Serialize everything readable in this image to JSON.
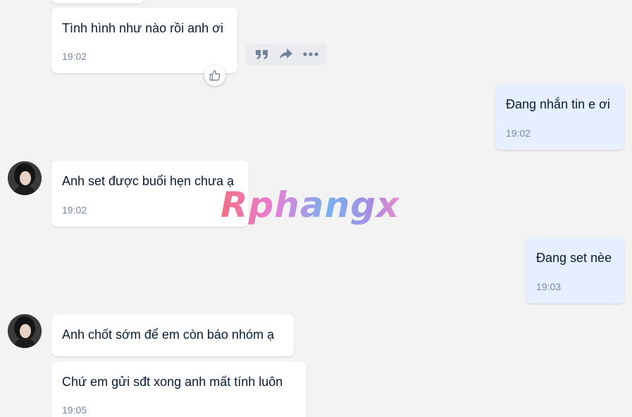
{
  "watermark": "Rphangx",
  "messages": {
    "m1": {
      "text": "Tình hình như nào rồi anh ơi",
      "time": "19:02"
    },
    "m2": {
      "text": "Đang nhắn tin e ơi",
      "time": "19:02"
    },
    "m3": {
      "text": "Anh set được buổi hẹn chưa ạ",
      "time": "19:02"
    },
    "m4": {
      "text": "Đang set nèe",
      "time": "19:03"
    },
    "m5": {
      "text": "Anh chốt sớm để em còn báo nhóm ạ"
    },
    "m6": {
      "text": "Chứ em gửi sđt xong anh mất tính luôn",
      "time": "19:05"
    }
  },
  "hover_actions": [
    "quote-icon",
    "forward-icon",
    "more-icon"
  ],
  "reaction": "thumbs-up-icon",
  "colors": {
    "background": "#f3f3f3",
    "received_bubble": "#ffffff",
    "sent_bubble": "#e5efff",
    "time_text": "#7589a3",
    "message_text": "#081c36"
  }
}
